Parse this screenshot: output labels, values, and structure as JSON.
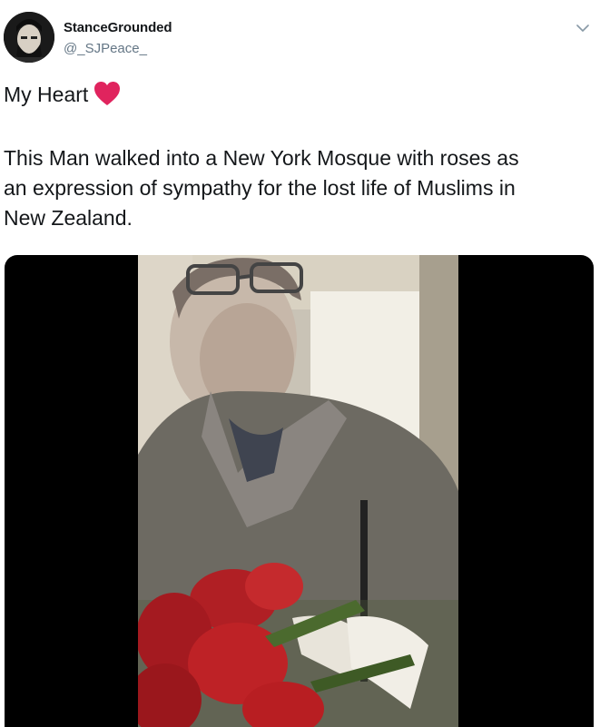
{
  "author": {
    "display_name": "StanceGrounded",
    "handle": "@_SJPeace_"
  },
  "tweet": {
    "line1": "My Heart",
    "line1_emoji": "red-heart-icon",
    "body_lines": [
      "This Man walked into a New York Mosque with roses as",
      "an expression of sympathy for the lost life of Muslims in",
      "New Zealand."
    ]
  },
  "icons": {
    "menu": "chevron-down-icon"
  },
  "colors": {
    "text": "#14171a",
    "secondary": "#657786",
    "heart": "#e0245e",
    "media_background": "#000000"
  }
}
